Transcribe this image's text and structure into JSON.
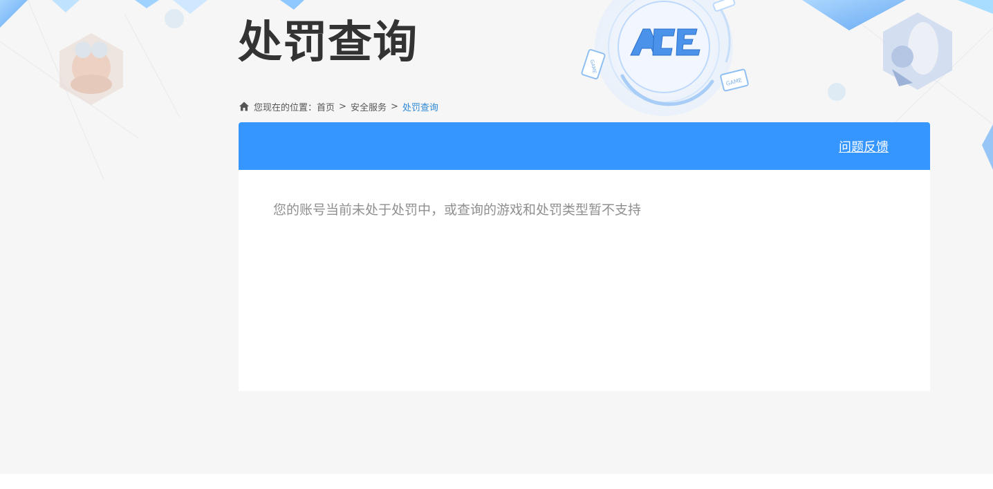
{
  "header": {
    "title": "处罚查询",
    "logo_text": "ACE",
    "game_badge_left": "GAME",
    "game_badge_right": "GAME"
  },
  "breadcrumb": {
    "prefix": "您现在的位置：",
    "items": [
      "首页",
      "安全服务",
      "处罚查询"
    ],
    "separator": ">"
  },
  "panel": {
    "feedback_label": "问题反馈",
    "status_message": "您的账号当前未处于处罚中，或查询的游戏和处罚类型暂不支持"
  },
  "colors": {
    "accent": "#3596ff",
    "link_current": "#2b88d8",
    "title": "#333333",
    "message": "#8f8f8f",
    "background": "#f6f6f6"
  },
  "icons": {
    "home": "home-icon",
    "logo": "ace-logo-icon",
    "game_left": "game-device-icon",
    "game_right": "game-device-icon",
    "avatar_left": "cartoon-character-avatar",
    "avatar_right": "fantasy-character-avatar"
  }
}
